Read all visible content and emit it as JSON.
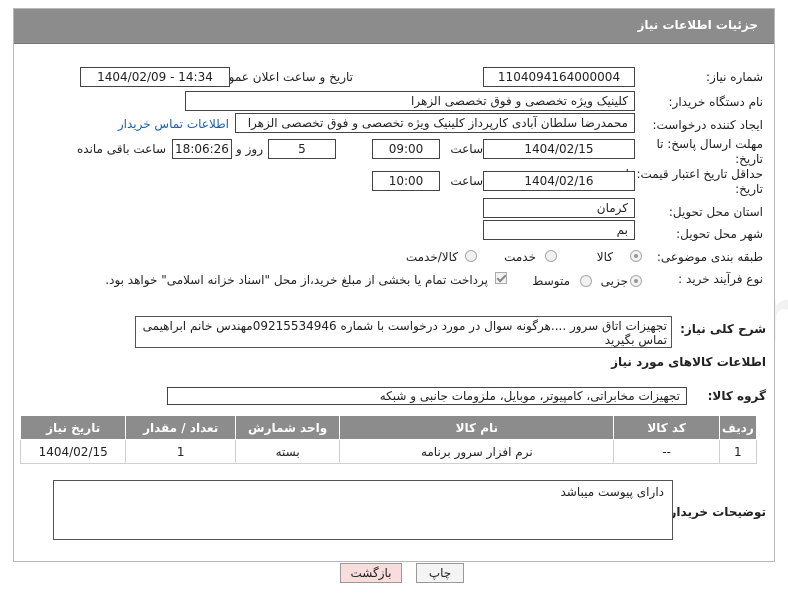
{
  "header": {
    "title": "جزئیات اطلاعات نیاز"
  },
  "need_number": {
    "label": "شماره نیاز:",
    "value": "1104094164000004"
  },
  "announce": {
    "label": "تاریخ و ساعت اعلان عمومی:",
    "value": "1404/02/09 - 14:34"
  },
  "buyer_org": {
    "label": "نام دستگاه خریدار:",
    "value": "کلینیک ویژه تخصصی و فوق تخصصی الزهرا"
  },
  "creator": {
    "label": "ایجاد کننده درخواست:",
    "value": "محمدرضا سلطان آبادی کارپرداز کلینیک ویژه تخصصی و فوق تخصصی الزهرا",
    "contact_link": "اطلاعات تماس خریدار"
  },
  "reply_deadline": {
    "label": "مهلت ارسال پاسخ: تا تاریخ:",
    "date": "1404/02/15",
    "time_label": "ساعت",
    "time": "09:00",
    "days": "5",
    "days_label": "روز و",
    "remaining": "18:06:26",
    "remaining_label": "ساعت باقی مانده"
  },
  "price_validity": {
    "label": "حداقل تاریخ اعتبار قیمت: تا تاریخ:",
    "date": "1404/02/16",
    "time_label": "ساعت",
    "time": "10:00"
  },
  "province": {
    "label": "استان محل تحویل:",
    "value": "کرمان"
  },
  "city": {
    "label": "شهر محل تحویل:",
    "value": "بم"
  },
  "category": {
    "label": "طبقه بندی موضوعی:",
    "options": [
      "کالا",
      "خدمت",
      "کالا/خدمت"
    ]
  },
  "process": {
    "label": "نوع فرآیند خرید :",
    "options": [
      "جزیی",
      "متوسط"
    ],
    "note": "پرداخت تمام یا بخشی از مبلغ خرید،از محل \"اسناد خزانه اسلامی\" خواهد بود."
  },
  "description": {
    "label": "شرح کلی نیاز:",
    "value": "تجهیزات اتاق سرور ....هرگونه سوال در مورد درخواست با شماره 09215534946مهندس خانم ابراهیمی تماس بگیرید"
  },
  "goods_info": {
    "title": "اطلاعات کالاهای مورد نیاز"
  },
  "goods_group": {
    "label": "گروه کالا:",
    "value": "تجهیزات مخابراتی، کامپیوتر، موبایل، ملزومات جانبی و شبکه"
  },
  "table": {
    "headers": [
      "ردیف",
      "کد کالا",
      "نام کالا",
      "واحد شمارش",
      "تعداد / مقدار",
      "تاریخ نیاز"
    ],
    "rows": [
      [
        "1",
        "--",
        "نرم افزار سرور برنامه",
        "بسته",
        "1",
        "1404/02/15"
      ]
    ]
  },
  "buyer_notes": {
    "label": "توضیحات خریدار:",
    "value": "دارای پیوست میباشد"
  },
  "buttons": {
    "print": "چاپ",
    "back": "بازگشت"
  },
  "watermark": "AriaTender.neT",
  "colors": {
    "header_bg": "#8c8c8c",
    "link": "#1a5fb4",
    "back_btn_bg": "#f9dcdc"
  }
}
